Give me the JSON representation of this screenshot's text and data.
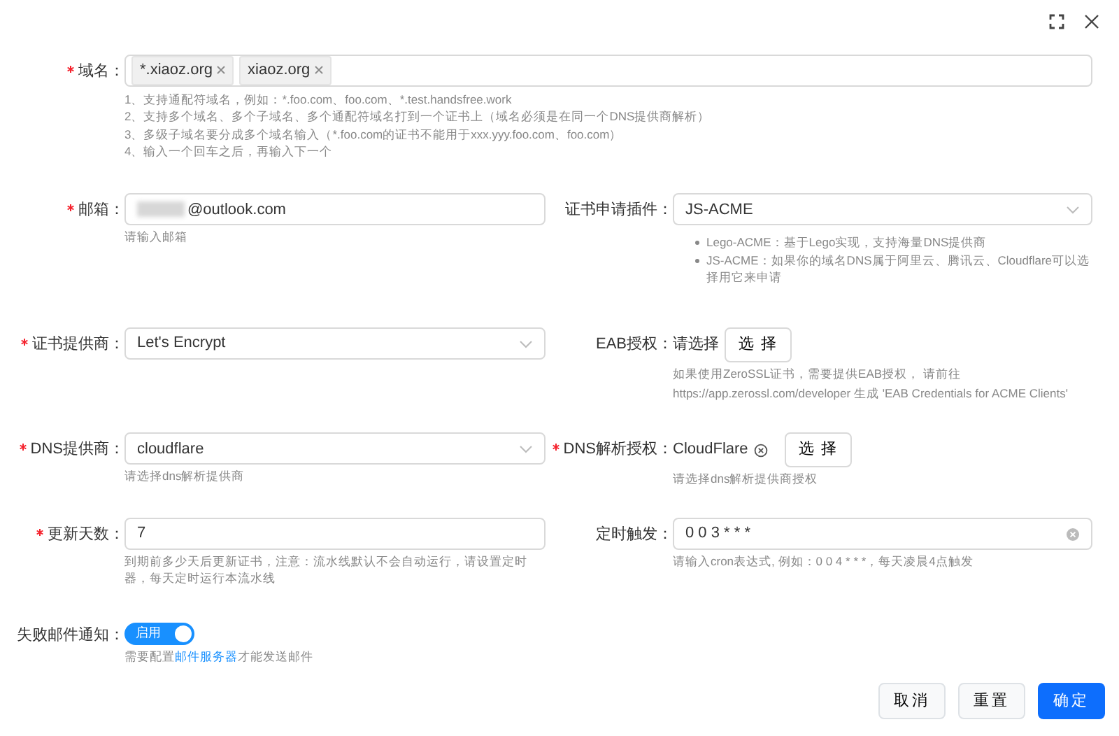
{
  "dialog": {
    "submit": "确定",
    "reset": "重置",
    "cancel": "取消"
  },
  "rows": [
    {
      "cells": [
        {
          "kind": "tags",
          "label": "域名：",
          "required": true,
          "tags": [
            "*.xiaoz.org",
            "xiaoz.org"
          ],
          "help_lines": [
            "1、支持通配符域名，例如：*.foo.com、foo.com、*.test.handsfree.work",
            "2、支持多个域名、多个子域名、多个通配符域名打到一个证书上（域名必须是在同一个DNS提供商解析）",
            "3、多级子域名要分成多个域名输入（*.foo.com的证书不能用于xxx.yyy.foo.com、foo.com）",
            "4、输入一个回车之后，再输入下一个"
          ]
        }
      ]
    },
    {
      "cells": [
        {
          "kind": "text",
          "label": "邮箱：",
          "required": true,
          "value": "@outlook.com",
          "masked_prefix": true,
          "help_lines": [
            "请输入邮箱"
          ]
        },
        {
          "kind": "select",
          "label": "证书申请插件：",
          "required": false,
          "value": "JS-ACME",
          "help_bullets": [
            "Lego-ACME：基于Lego实现，支持海量DNS提供商",
            "JS-ACME：如果你的域名DNS属于阿里云、腾讯云、Cloudflare可以选择用它来申请"
          ]
        }
      ]
    },
    {
      "cells": [
        {
          "kind": "select",
          "label": "证书提供商：",
          "required": true,
          "value": "Let's Encrypt"
        },
        {
          "kind": "choose",
          "label": "EAB授权：",
          "required": false,
          "value": "请选择",
          "button": "选 择",
          "help_lines": [
            "如果使用ZeroSSL证书，需要提供EAB授权， 请前往",
            "https://app.zerossl.com/developer 生成 'EAB Credentials for ACME Clients'"
          ]
        }
      ]
    },
    {
      "cells": [
        {
          "kind": "select",
          "label": "DNS提供商：",
          "required": true,
          "value": "cloudflare",
          "help_lines": [
            "请选择dns解析提供商"
          ]
        },
        {
          "kind": "choose",
          "label": "DNS解析授权：",
          "required": true,
          "value": "CloudFlare",
          "clearable": true,
          "button": "选 择",
          "help_lines": [
            "请选择dns解析提供商授权"
          ]
        }
      ]
    },
    {
      "cells": [
        {
          "kind": "text",
          "label": "更新天数：",
          "required": true,
          "value": "7",
          "help_lines": [
            "到期前多少天后更新证书，注意：流水线默认不会自动运行，请设置定时器，每天定时运行本流水线"
          ]
        },
        {
          "kind": "text",
          "label": "定时触发：",
          "required": false,
          "value": "0 0 3 * * *",
          "clearable": true,
          "help_lines": [
            "请输入cron表达式, 例如：0 0 4 * * *，每天凌晨4点触发"
          ]
        }
      ]
    },
    {
      "cells": [
        {
          "kind": "toggle",
          "label": "失败邮件通知：",
          "required": false,
          "on": true,
          "text": "启用",
          "help_before": "需要配置",
          "help_link": "邮件服务器",
          "help_after": "才能发送邮件"
        }
      ]
    }
  ]
}
